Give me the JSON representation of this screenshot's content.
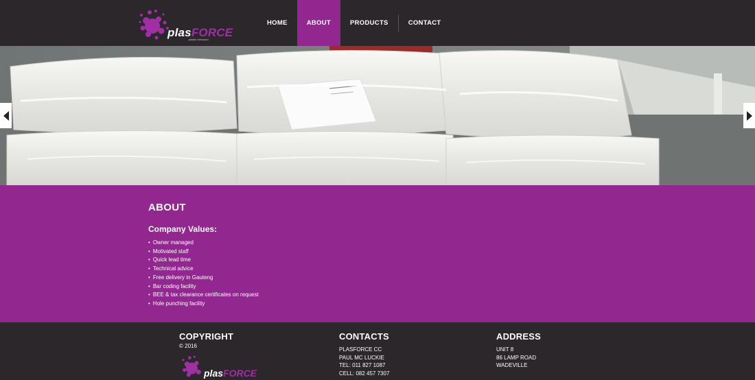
{
  "brand": {
    "name_part1": "plas",
    "name_part2": "FORCE",
    "tagline": "plastic extrusion"
  },
  "nav": {
    "items": [
      {
        "label": "HOME",
        "active": false
      },
      {
        "label": "ABOUT",
        "active": true
      },
      {
        "label": "PRODUCTS",
        "active": false
      },
      {
        "label": "CONTACT",
        "active": false
      }
    ]
  },
  "hero": {
    "prev_icon": "chevron-left-icon",
    "next_icon": "chevron-right-icon"
  },
  "about": {
    "heading": "ABOUT",
    "subheading": "Company Values:",
    "values": [
      "Owner managed",
      "Motivated staff",
      "Quick lead time",
      "Technical advice",
      "Free delivery in Gauteng",
      "Bar coding facility",
      "BEE & tax clearance certificates on request",
      "Hole punching facility"
    ]
  },
  "footer": {
    "copyright": {
      "heading": "COPYRIGHT",
      "text": "© 2016"
    },
    "contacts": {
      "heading": "CONTACTS",
      "lines": [
        "PLASFORCE CC",
        "PAUL MC LUCKIE",
        "TEL: 011 827 1087",
        "CELL: 082 457 7307"
      ]
    },
    "address": {
      "heading": "ADDRESS",
      "lines": [
        "UNIT 8",
        "86 LAMP ROAD",
        "WADEVILLE"
      ]
    }
  },
  "colors": {
    "accent": "#92278f",
    "dark": "#2b272b"
  }
}
